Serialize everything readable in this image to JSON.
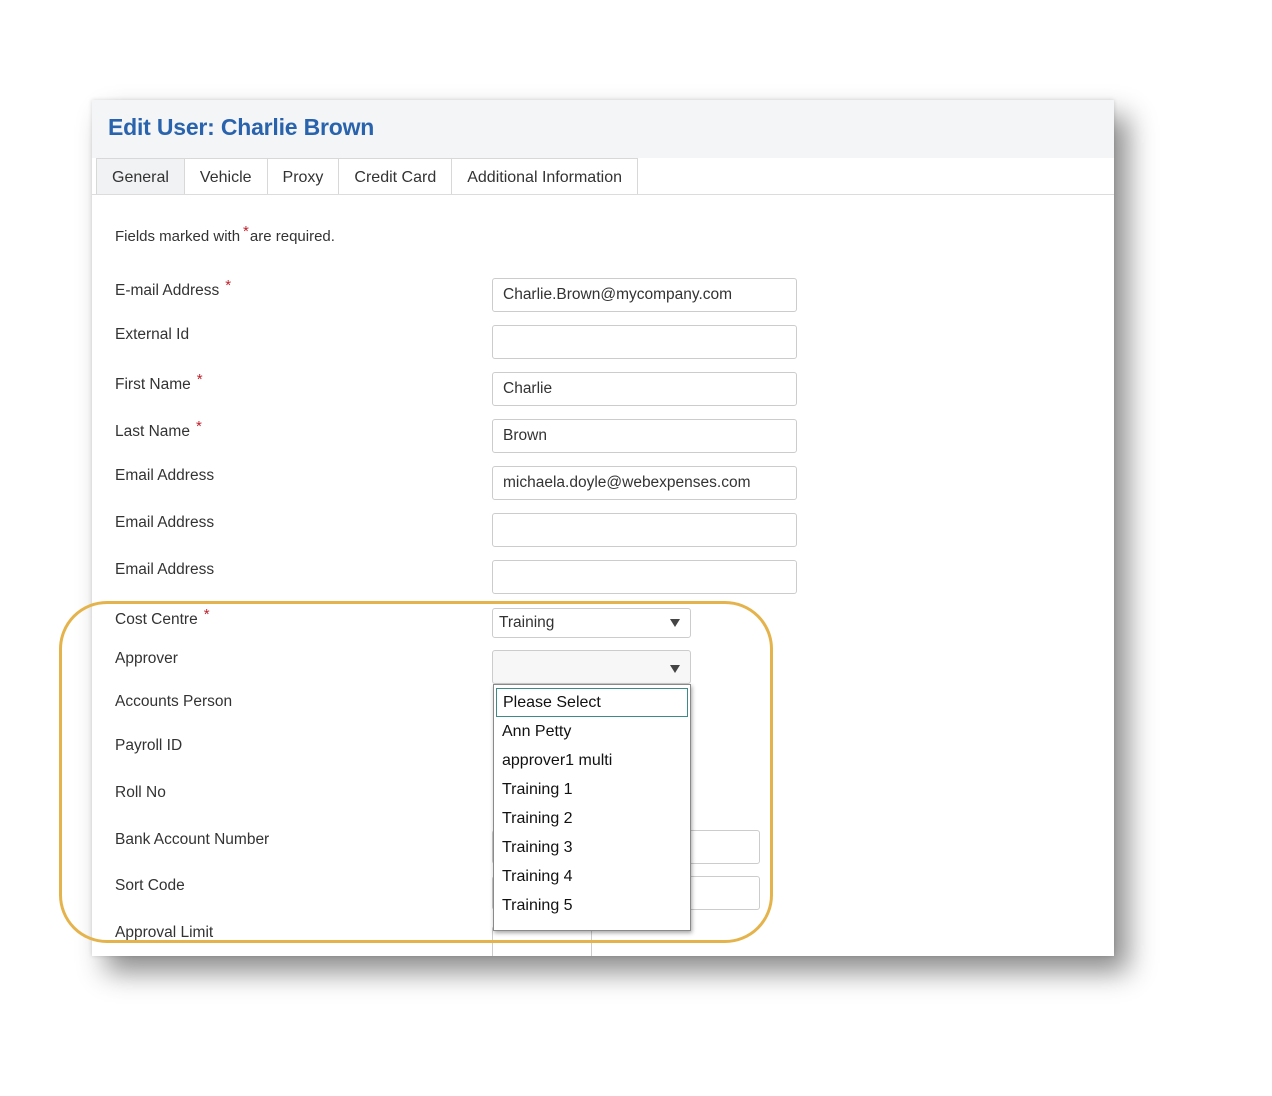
{
  "page": {
    "title": "Edit User: Charlie Brown",
    "required_note_before": "Fields marked with",
    "required_note_after": "are required.",
    "required_marker": "*"
  },
  "tabs": [
    {
      "label": "General",
      "active": true
    },
    {
      "label": "Vehicle",
      "active": false
    },
    {
      "label": "Proxy",
      "active": false
    },
    {
      "label": "Credit Card",
      "active": false
    },
    {
      "label": "Additional Information",
      "active": false
    }
  ],
  "fields": {
    "email_address": {
      "label": "E-mail Address",
      "value": "Charlie.Brown@mycompany.com",
      "required": true
    },
    "external_id": {
      "label": "External Id",
      "value": ""
    },
    "first_name": {
      "label": "First Name",
      "value": "Charlie",
      "required": true
    },
    "last_name": {
      "label": "Last Name",
      "value": "Brown",
      "required": true
    },
    "email_1": {
      "label": "Email Address",
      "value": "michaela.doyle@webexpenses.com"
    },
    "email_2": {
      "label": "Email Address",
      "value": ""
    },
    "email_3": {
      "label": "Email Address",
      "value": ""
    },
    "cost_centre": {
      "label": "Cost Centre",
      "value": "Training",
      "required": true
    },
    "approver": {
      "label": "Approver",
      "value": ""
    },
    "accounts_person": {
      "label": "Accounts Person"
    },
    "payroll_id": {
      "label": "Payroll ID"
    },
    "roll_no": {
      "label": "Roll No"
    },
    "bank_account_number": {
      "label": "Bank Account Number",
      "value": ""
    },
    "sort_code": {
      "label": "Sort Code",
      "value": ""
    },
    "approval_limit": {
      "label": "Approval Limit"
    }
  },
  "approver_dropdown": {
    "options": [
      "Please Select",
      "Ann Petty",
      "approver1 multi",
      "Training 1",
      "Training 2",
      "Training 3",
      "Training 4",
      "Training 5"
    ],
    "highlighted": "Please Select"
  },
  "colors": {
    "title": "#2a63ad",
    "required": "#c0202a",
    "highlight_ring": "#e5b34c",
    "option_focus": "#3d8a86"
  },
  "icons": {
    "select_caret": "chevron-down-icon"
  }
}
